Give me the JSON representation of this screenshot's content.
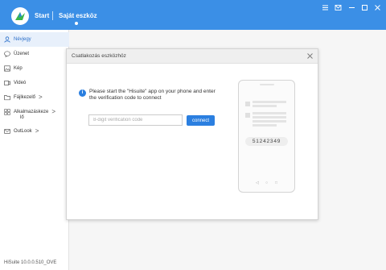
{
  "titlebar": {
    "nav_start": "Start",
    "nav_mine": "Saját eszköz",
    "brand_color": "#3b8fe6"
  },
  "sidebar": {
    "items": [
      {
        "label": "Névjegy",
        "icon": "person-icon",
        "active": true
      },
      {
        "label": "Üzenet",
        "icon": "chat-icon"
      },
      {
        "label": "Kép",
        "icon": "image-icon"
      },
      {
        "label": "Videó",
        "icon": "video-icon"
      },
      {
        "label": "Fájlkezelő",
        "icon": "folder-icon",
        "chevron": ">"
      },
      {
        "label": "Alkalmazáskezelő",
        "label_line1": "Alkalmazáskeze",
        "label_line2": "lő",
        "icon": "apps-icon",
        "chevron": ">"
      },
      {
        "label": "OutLook",
        "icon": "mail-icon",
        "chevron": ">"
      }
    ],
    "version": "HiSuite 10.0.0.510_OVE"
  },
  "dialog": {
    "title": "Csatlakozás eszközhöz",
    "instruction": "Please start the \"Hisuite\" app on your phone and enter the verification code to connect",
    "input_placeholder": "8-digit verification code",
    "input_value": "",
    "connect_label": "connect",
    "phone_code": "51242349",
    "accent_color": "#2b7fe0"
  }
}
